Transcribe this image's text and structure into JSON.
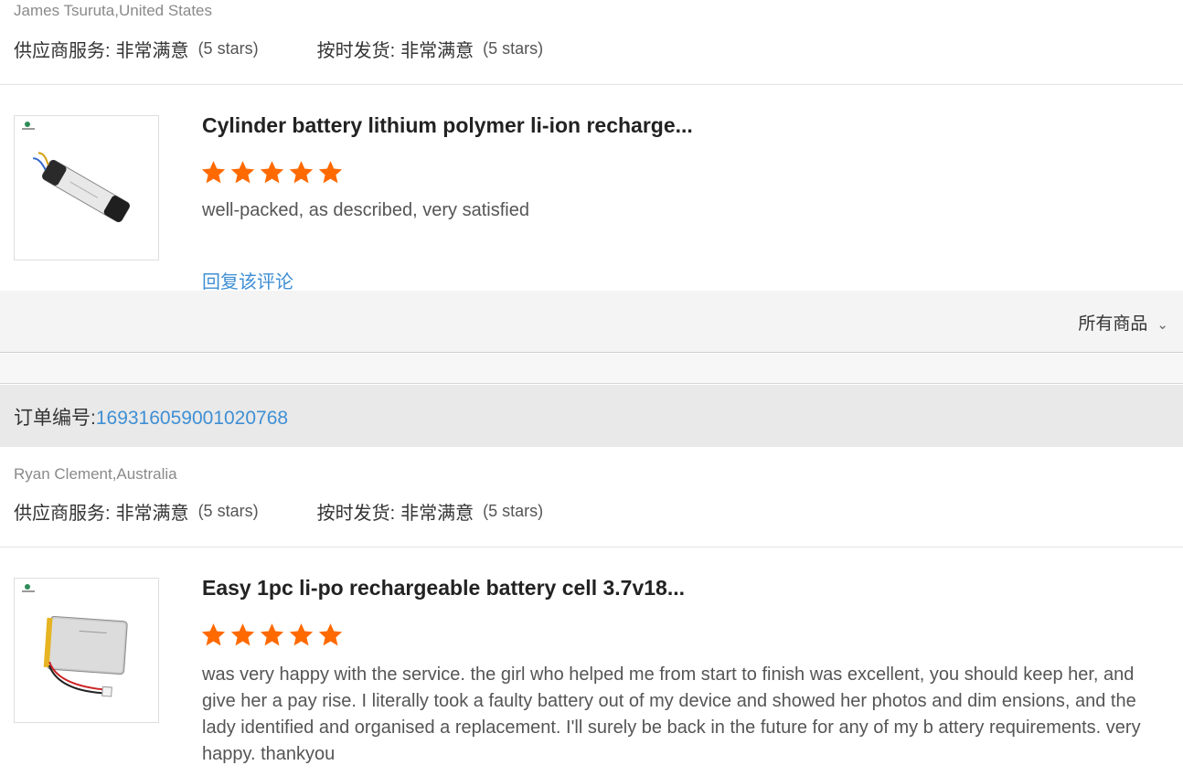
{
  "reviews": [
    {
      "reviewer": "James Tsuruta,United States",
      "ratings": [
        {
          "label": "供应商服务:",
          "value": "非常满意",
          "stars": "(5 stars)"
        },
        {
          "label": "按时发货:",
          "value": "非常满意",
          "stars": "(5 stars)"
        }
      ],
      "product": {
        "title": "Cylinder battery lithium polymer li-ion recharge...",
        "rating": 5,
        "text": "well-packed, as described, very satisfied",
        "image_icon": "cylinder-battery-icon"
      },
      "reply_label": "回复该评论"
    },
    {
      "reviewer": "Ryan Clement,Australia",
      "ratings": [
        {
          "label": "供应商服务:",
          "value": "非常满意",
          "stars": "(5 stars)"
        },
        {
          "label": "按时发货:",
          "value": "非常满意",
          "stars": "(5 stars)"
        }
      ],
      "product": {
        "title": "Easy 1pc li-po rechargeable battery cell 3.7v18...",
        "rating": 5,
        "text": "was very happy with the service. the girl who helped me from start to finish was excellent, you should keep her, and give her a pay rise. I literally took a faulty battery out of my device and showed her photos and dim ensions, and the lady identified and organised a replacement. I'll surely be back in the future for any of my b attery requirements. very happy. thankyou",
        "image_icon": "lipo-battery-icon"
      }
    }
  ],
  "filter": {
    "label": "所有商品",
    "icon": "chevron-down-icon"
  },
  "order": {
    "label": "订单编号:",
    "number": "169316059001020768"
  },
  "colors": {
    "star": "#ff6a00",
    "link": "#3f8fd4",
    "order_bar": "#e9e9e9",
    "filter_bar": "#f4f4f4"
  }
}
